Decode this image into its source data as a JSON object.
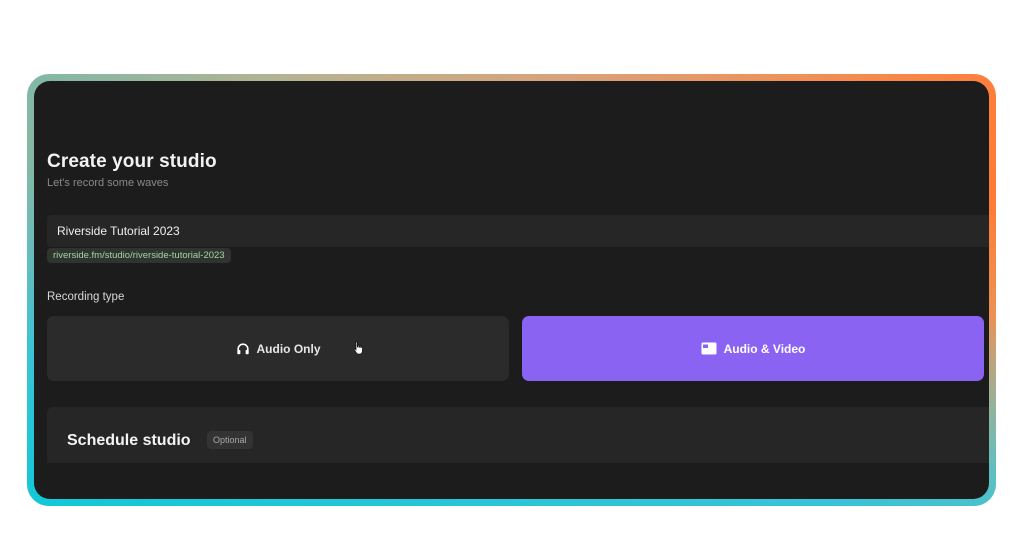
{
  "studio": {
    "title": "Create your studio",
    "subtitle": "Let's record some waves",
    "name_value": "Riverside Tutorial 2023",
    "url": "riverside.fm/studio/riverside-tutorial-2023"
  },
  "recording": {
    "label": "Recording type",
    "options": [
      {
        "label": "Audio Only",
        "icon": "headphones-icon",
        "selected": false
      },
      {
        "label": "Audio & Video",
        "icon": "video-window-icon",
        "selected": true
      }
    ]
  },
  "schedule": {
    "title": "Schedule studio",
    "badge": "Optional"
  },
  "colors": {
    "background": "#1c1c1c",
    "accent": "#8a63f3",
    "url_text": "#9ed7a2",
    "frame_gradient": [
      "#10c8d8",
      "#b6b392",
      "#ff7a34"
    ]
  }
}
